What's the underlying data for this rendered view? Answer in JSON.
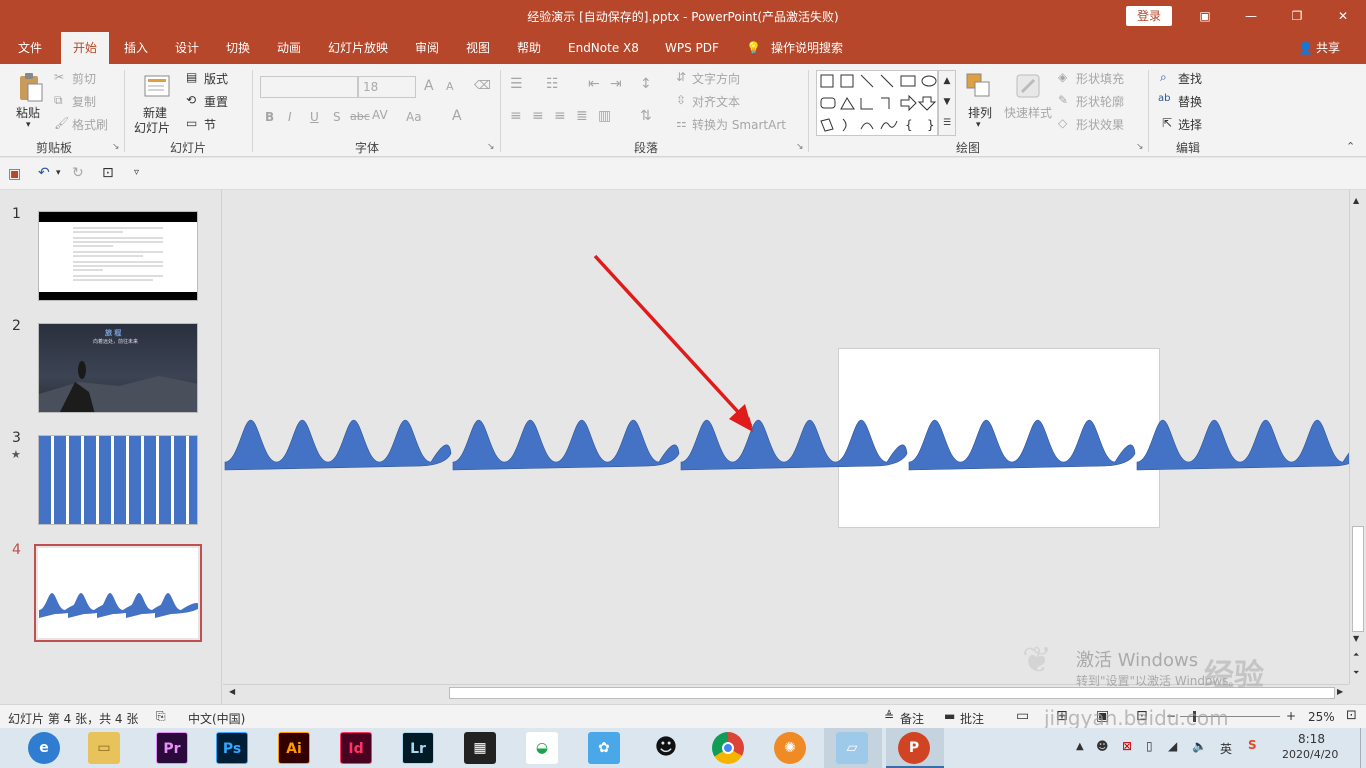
{
  "window": {
    "title": "经验演示 [自动保存的].pptx  -  PowerPoint(产品激活失败)",
    "login_label": "登录",
    "controls": [
      "ribbon-display-icon",
      "minimize-icon",
      "restore-icon",
      "close-icon"
    ]
  },
  "tabs": [
    {
      "label": "文件"
    },
    {
      "label": "开始",
      "active": true
    },
    {
      "label": "插入"
    },
    {
      "label": "设计"
    },
    {
      "label": "切换"
    },
    {
      "label": "动画"
    },
    {
      "label": "幻灯片放映"
    },
    {
      "label": "审阅"
    },
    {
      "label": "视图"
    },
    {
      "label": "帮助"
    },
    {
      "label": "EndNote X8"
    },
    {
      "label": "WPS PDF"
    }
  ],
  "tell_me": "操作说明搜索",
  "share": "共享",
  "ribbon": {
    "clipboard": {
      "paste": "粘贴",
      "cut": "剪切",
      "copy": "复制",
      "format_painter": "格式刷",
      "label": "剪贴板"
    },
    "slides": {
      "new_slide_1": "新建",
      "new_slide_2": "幻灯片",
      "layout": "版式",
      "reset": "重置",
      "section": "节",
      "label": "幻灯片"
    },
    "font": {
      "font_name": "",
      "font_size": "18",
      "label": "字体",
      "bold": "B",
      "italic": "I",
      "underline": "U",
      "shadow": "S",
      "strike": "abc",
      "spacing": "AV",
      "case": "Aa",
      "color": "A",
      "grow": "A",
      "shrink": "A"
    },
    "paragraph": {
      "text_direction": "文字方向",
      "align_text": "对齐文本",
      "smartart": "转换为 SmartArt",
      "label": "段落"
    },
    "drawing": {
      "arrange": "排列",
      "quick_styles": "快速样式",
      "shape_fill": "形状填充",
      "shape_outline": "形状轮廓",
      "shape_effects": "形状效果",
      "label": "绘图"
    },
    "editing": {
      "find": "查找",
      "replace": "替换",
      "select": "选择",
      "label": "编辑"
    }
  },
  "thumbnails": [
    {
      "num": "1",
      "star": false
    },
    {
      "num": "2",
      "star": false,
      "caption_1": "旅 程",
      "caption_2": "向着远处，前往未来"
    },
    {
      "num": "3",
      "star": true
    },
    {
      "num": "4",
      "star": false,
      "selected": true
    }
  ],
  "colors": {
    "accent": "#b7472a",
    "wave": "#4472c4",
    "arrow": "#e01b1b",
    "selected_border": "#c0504d"
  },
  "status": {
    "slide_info": "幻灯片 第 4 张，共 4 张",
    "language": "中文(中国)",
    "notes": "备注",
    "comments": "批注",
    "zoom": "25%"
  },
  "watermark": {
    "activate_1": "激活 Windows",
    "activate_2": "转到\"设置\"以激活 Windows。",
    "jingyan": "经验",
    "url": "jingyan.baidu.com"
  },
  "taskbar": {
    "apps": [
      "edge",
      "explorer",
      "Pr",
      "Ps",
      "Ai",
      "Id",
      "Lr",
      "video",
      "paint",
      "feishu",
      "qq",
      "chrome",
      "pinwheel",
      "notepad",
      "powerpoint"
    ],
    "time": "8:18",
    "date": "2020/4/20",
    "ime": "英"
  }
}
